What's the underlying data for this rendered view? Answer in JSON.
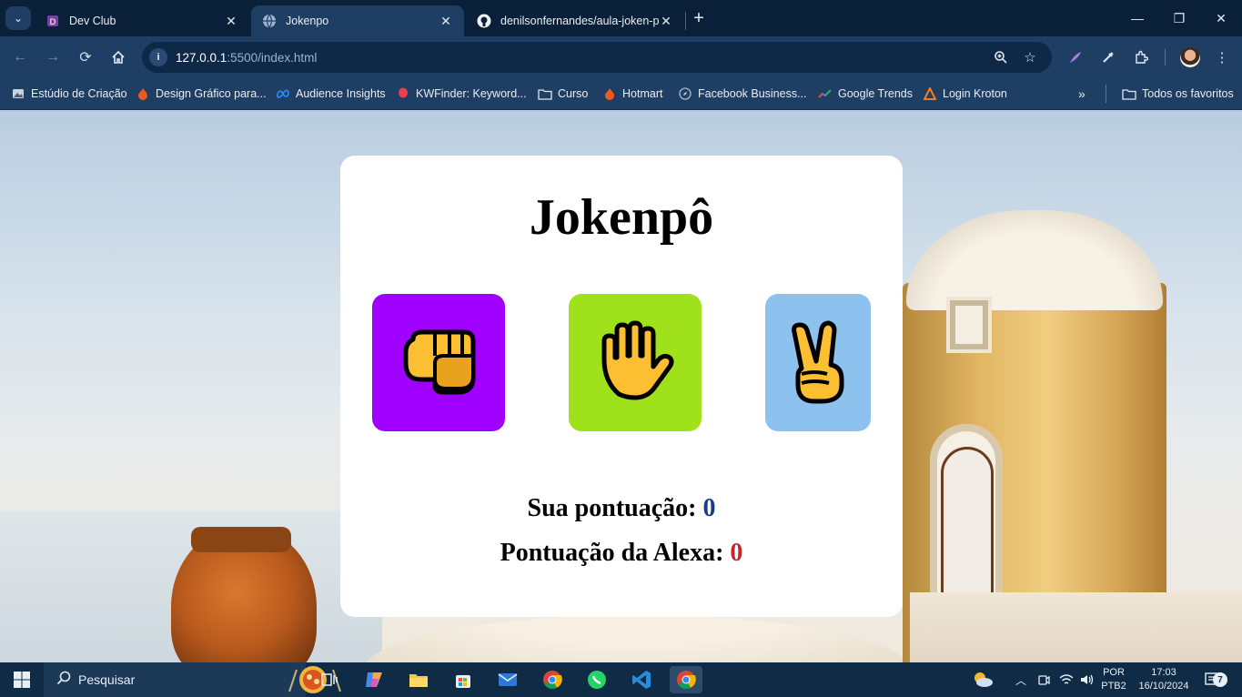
{
  "browser": {
    "tabs": [
      {
        "title": "Dev Club",
        "icon": "devclub-icon",
        "active": false
      },
      {
        "title": "Jokenpo",
        "icon": "globe-icon",
        "active": true
      },
      {
        "title": "denilsonfernandes/aula-joken-p",
        "icon": "github-icon",
        "active": false
      }
    ],
    "url_host": "127.0.0.1",
    "url_rest": ":5500/index.html",
    "bookmarks": [
      {
        "label": "Estúdio de Criação",
        "icon": "image-icon"
      },
      {
        "label": "Design Gráfico para...",
        "icon": "flame-icon"
      },
      {
        "label": "Audience Insights",
        "icon": "meta-icon"
      },
      {
        "label": "KWFinder: Keyword...",
        "icon": "balloon-icon"
      },
      {
        "label": "Curso",
        "icon": "folder-icon"
      },
      {
        "label": "Hotmart",
        "icon": "flame-icon"
      },
      {
        "label": "Facebook Business...",
        "icon": "compass-icon"
      },
      {
        "label": "Google Trends",
        "icon": "trend-icon"
      },
      {
        "label": "Login Kroton",
        "icon": "triangle-icon"
      }
    ],
    "all_bookmarks_label": "Todos os favoritos"
  },
  "game": {
    "title": "Jokenpô",
    "choices": [
      {
        "name": "rock",
        "emoji": "👊",
        "color": "#A000FF"
      },
      {
        "name": "paper",
        "emoji": "🖐️",
        "color": "#9FE11B"
      },
      {
        "name": "scissors",
        "emoji": "✌️",
        "color": "#8DC2EE"
      }
    ],
    "player_score_label": "Sua pontuação: ",
    "player_score": "0",
    "player_score_color": "#1A3C8C",
    "machine_score_label": "Pontuação da Alexa: ",
    "machine_score": "0",
    "machine_score_color": "#C0282C"
  },
  "taskbar": {
    "search_placeholder": "Pesquisar",
    "language": "POR",
    "keyboard": "PTB2",
    "time": "17:03",
    "date": "16/10/2024",
    "notifications": "7"
  }
}
